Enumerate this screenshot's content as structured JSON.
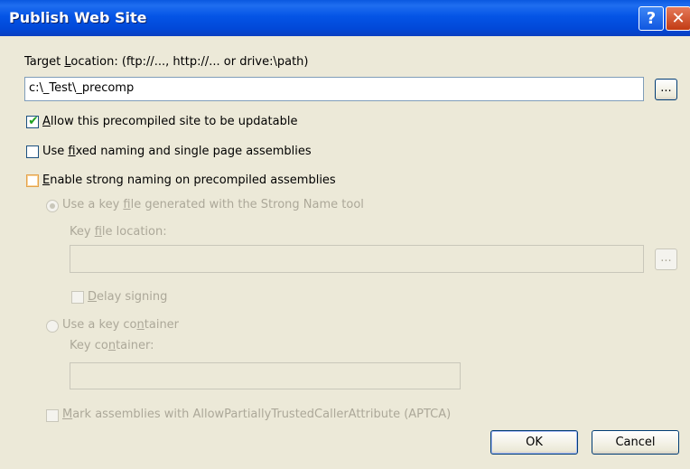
{
  "window": {
    "title": "Publish Web Site",
    "help_glyph": "?",
    "close_glyph": "✕"
  },
  "target": {
    "label_pre": "Target ",
    "label_key": "L",
    "label_post": "ocation: (ftp://..., http://... or drive:\\path)",
    "value": "c:\\_Test\\_precomp",
    "browse_label": "..."
  },
  "options": {
    "updatable": {
      "label_key": "A",
      "label_rest": "llow this precompiled site to be updatable",
      "checked": true
    },
    "fixed_naming": {
      "label_pre": "Use ",
      "label_key": "f",
      "label_rest": "ixed naming and single page assemblies",
      "checked": false
    },
    "strong_naming": {
      "label_key": "E",
      "label_rest": "nable strong naming on precompiled assemblies",
      "checked": false
    }
  },
  "strong": {
    "key_file_radio": {
      "label_pre": "Use a key ",
      "label_key": "f",
      "label_rest": "ile generated with the Strong Name tool",
      "selected": true
    },
    "key_file_location": {
      "label_pre": "Key ",
      "label_key": "f",
      "label_rest": "ile location:",
      "value": ""
    },
    "key_file_browse_label": "...",
    "delay_signing": {
      "label_key": "D",
      "label_rest": "elay signing",
      "checked": false
    },
    "key_container_radio": {
      "label_pre": "Use a key co",
      "label_key": "n",
      "label_rest": "tainer",
      "selected": false
    },
    "key_container": {
      "label_pre": "Key co",
      "label_key": "n",
      "label_rest": "tainer:",
      "value": ""
    },
    "aptca": {
      "label_key": "M",
      "label_rest": "ark assemblies with AllowPartiallyTrustedCallerAttribute (APTCA)",
      "checked": false
    }
  },
  "buttons": {
    "ok": "OK",
    "cancel": "Cancel"
  },
  "colors": {
    "title_bar": "#0454e6",
    "dialog_bg": "#ece9d8",
    "disabled_text": "#aca899",
    "checkmark": "#21a121"
  }
}
